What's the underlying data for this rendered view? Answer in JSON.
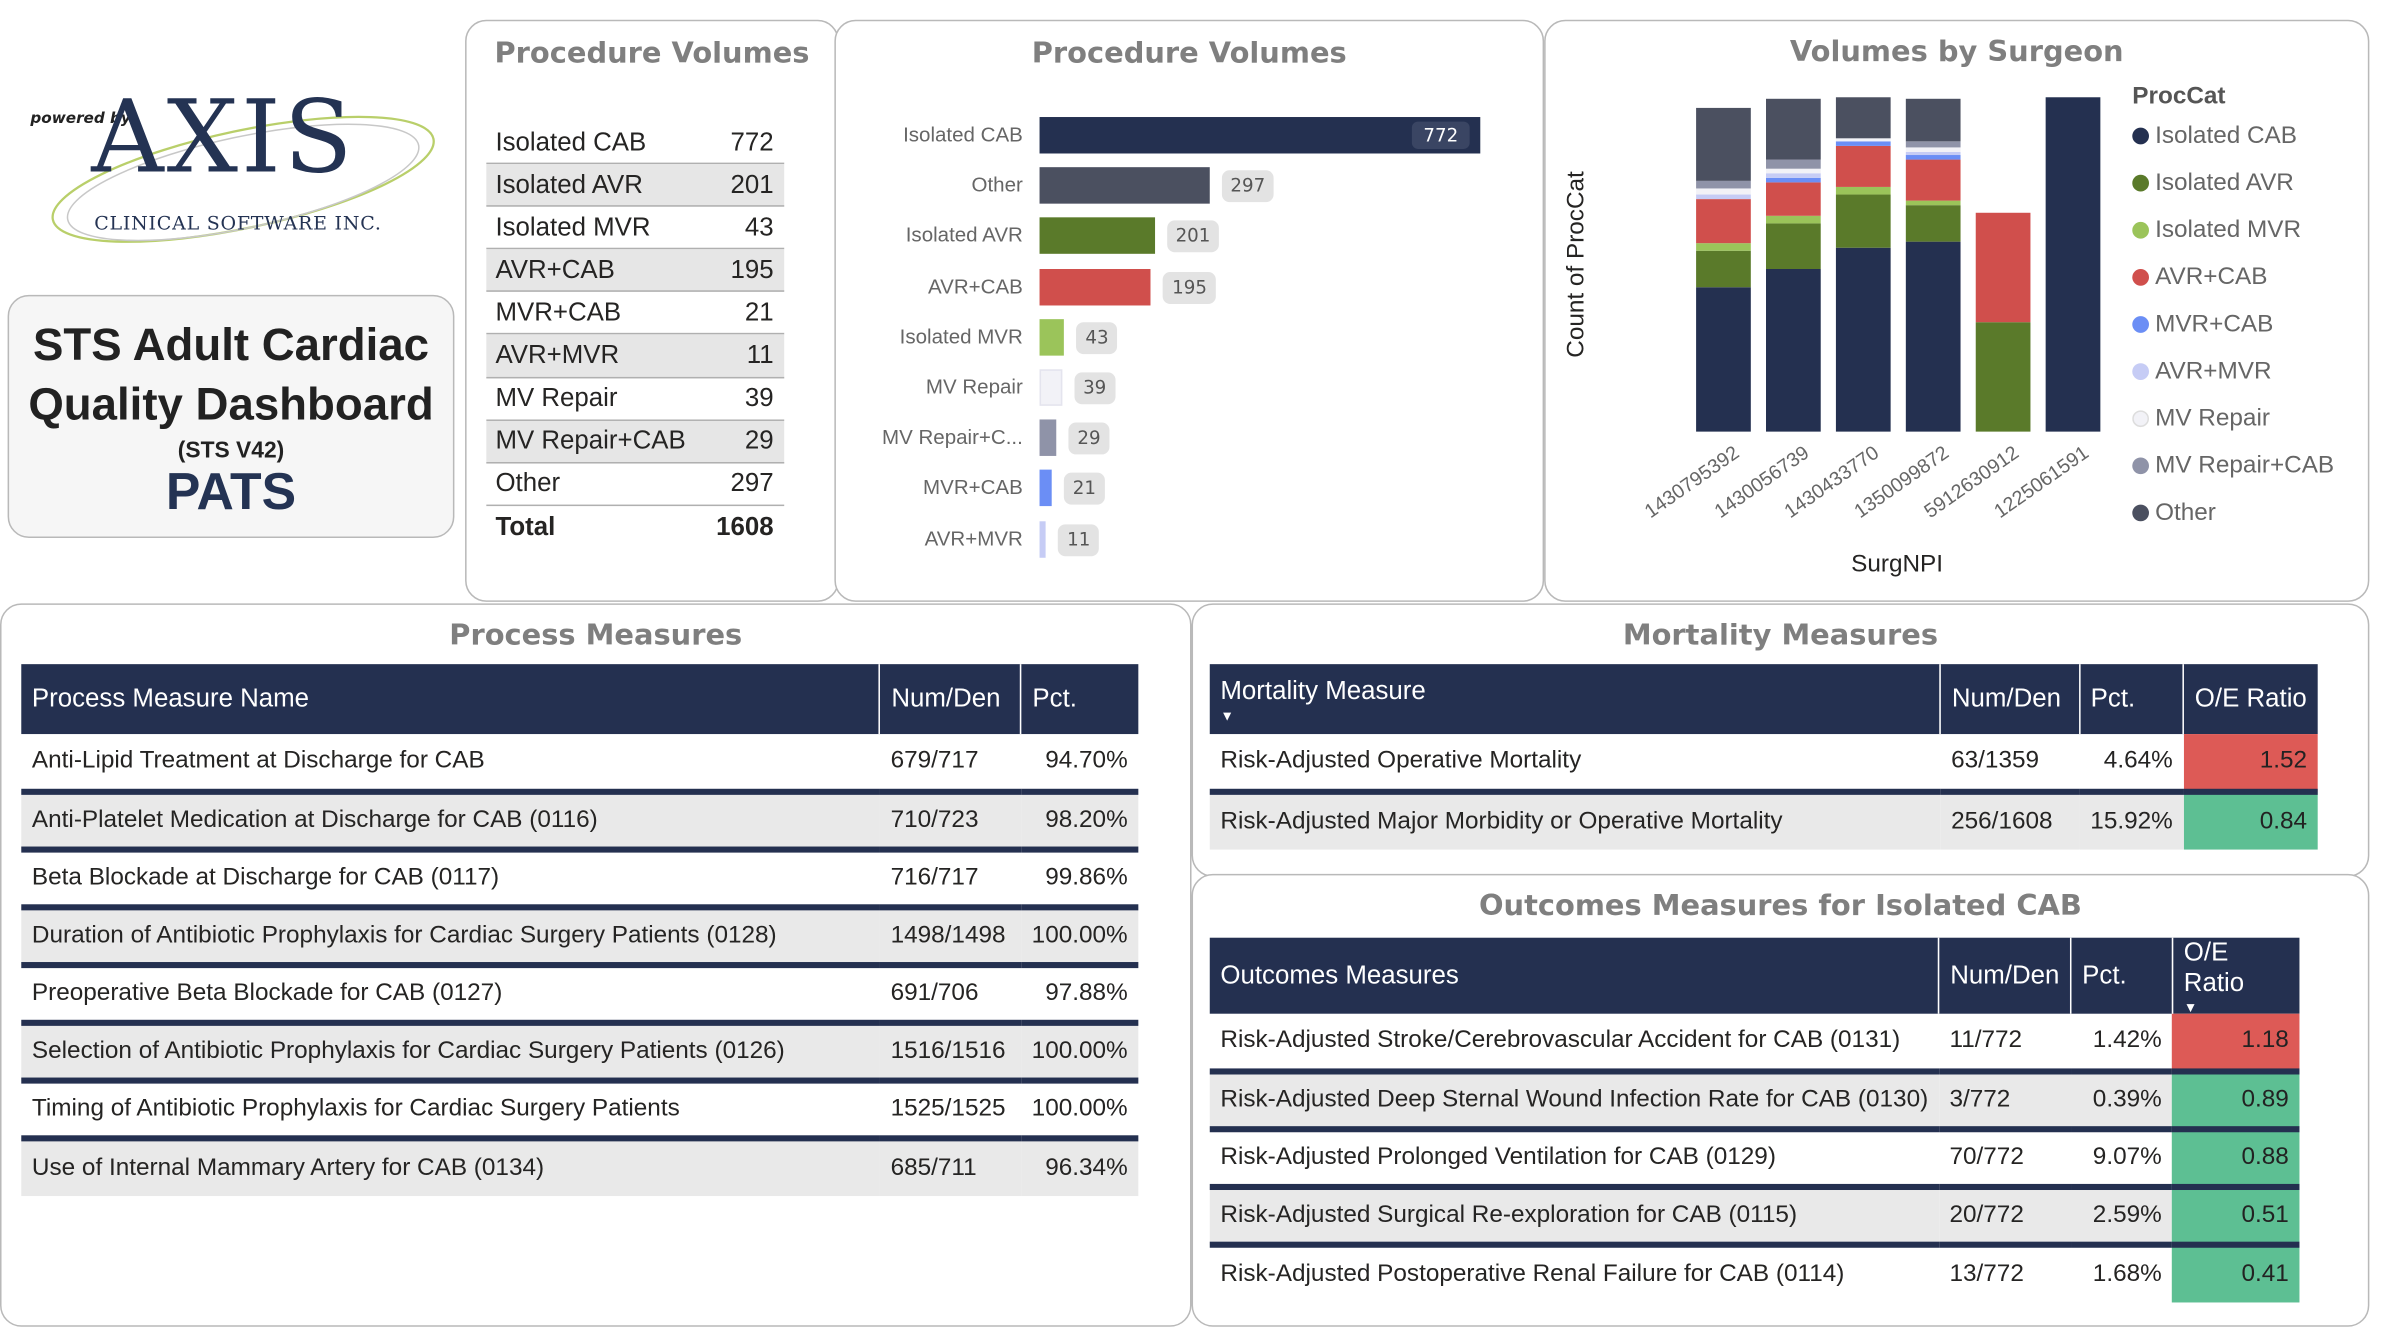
{
  "logo": {
    "powered_by": "powered by",
    "brand": "AXIS",
    "subtitle": "CLINICAL SOFTWARE INC."
  },
  "title_card": {
    "line1": "STS Adult Cardiac",
    "line2": "Quality Dashboard",
    "version": "(STS V42)",
    "pats": "PATS"
  },
  "volume_table": {
    "title": "Procedure Volumes",
    "rows": [
      {
        "name": "Isolated CAB",
        "value": "772"
      },
      {
        "name": "Isolated AVR",
        "value": "201"
      },
      {
        "name": "Isolated MVR",
        "value": "43"
      },
      {
        "name": "AVR+CAB",
        "value": "195"
      },
      {
        "name": "MVR+CAB",
        "value": "21"
      },
      {
        "name": "AVR+MVR",
        "value": "11"
      },
      {
        "name": "MV Repair",
        "value": "39"
      },
      {
        "name": "MV Repair+CAB",
        "value": "29"
      },
      {
        "name": "Other",
        "value": "297"
      }
    ],
    "total_label": "Total",
    "total_value": "1608"
  },
  "chart_data": [
    {
      "type": "bar",
      "orientation": "horizontal",
      "title": "Procedure Volumes",
      "categories": [
        "Isolated CAB",
        "Other",
        "Isolated AVR",
        "AVR+CAB",
        "Isolated MVR",
        "MV Repair",
        "MV Repair+C...",
        "MVR+CAB",
        "AVR+MVR"
      ],
      "values": [
        772,
        297,
        201,
        195,
        43,
        39,
        29,
        21,
        11
      ],
      "colors": [
        "#243050",
        "#4b5060",
        "#5a7a2a",
        "#d04f4c",
        "#9bc45a",
        "#f2f2f7",
        "#8f93a8",
        "#6b8ef5",
        "#c6ccf5"
      ]
    },
    {
      "type": "bar",
      "stacked": true,
      "title": "Volumes by Surgeon",
      "xlabel": "SurgNPI",
      "ylabel": "Count of ProcCat",
      "legend_title": "ProcCat",
      "legend_position": "right",
      "categories": [
        "1430795392",
        "1430056739",
        "1430433770",
        "1350099872",
        "5912630912",
        "1225061591"
      ],
      "series": [
        {
          "name": "Isolated CAB",
          "color": "#243050",
          "values": [
            95,
            107,
            121,
            125,
            0,
            220
          ]
        },
        {
          "name": "Isolated AVR",
          "color": "#5a7a2a",
          "values": [
            24,
            30,
            35,
            24,
            72,
            0
          ]
        },
        {
          "name": "Isolated MVR",
          "color": "#9bc45a",
          "values": [
            5,
            5,
            5,
            3,
            0,
            0
          ]
        },
        {
          "name": "AVR+CAB",
          "color": "#d04f4c",
          "values": [
            29,
            22,
            27,
            27,
            72,
            0
          ]
        },
        {
          "name": "MVR+CAB",
          "color": "#6b8ef5",
          "values": [
            0,
            3,
            3,
            3,
            0,
            0
          ]
        },
        {
          "name": "AVR+MVR",
          "color": "#c6ccf5",
          "values": [
            3,
            3,
            0,
            2,
            0,
            0
          ]
        },
        {
          "name": "MV Repair",
          "color": "#f2f2f7",
          "values": [
            4,
            3,
            2,
            3,
            0,
            0
          ]
        },
        {
          "name": "MV Repair+CAB",
          "color": "#8f93a8",
          "values": [
            5,
            6,
            0,
            4,
            0,
            0
          ]
        },
        {
          "name": "Other",
          "color": "#4b5060",
          "values": [
            48,
            40,
            27,
            28,
            0,
            0
          ]
        }
      ]
    }
  ],
  "process": {
    "title": "Process Measures",
    "headers": [
      "Process Measure Name",
      "Num/Den",
      "Pct."
    ],
    "rows": [
      [
        "Anti-Lipid Treatment at Discharge for CAB",
        "679/717",
        "94.70%"
      ],
      [
        "Anti-Platelet Medication at Discharge for CAB (0116)",
        "710/723",
        "98.20%"
      ],
      [
        "Beta Blockade at Discharge for CAB (0117)",
        "716/717",
        "99.86%"
      ],
      [
        "Duration of Antibiotic Prophylaxis for Cardiac Surgery Patients (0128)",
        "1498/1498",
        "100.00%"
      ],
      [
        "Preoperative Beta Blockade for CAB (0127)",
        "691/706",
        "97.88%"
      ],
      [
        "Selection of Antibiotic Prophylaxis for Cardiac Surgery Patients (0126)",
        "1516/1516",
        "100.00%"
      ],
      [
        "Timing of Antibiotic Prophylaxis for Cardiac Surgery Patients",
        "1525/1525",
        "100.00%"
      ],
      [
        "Use of Internal Mammary Artery for CAB (0134)",
        "685/711",
        "96.34%"
      ]
    ]
  },
  "mortality": {
    "title": "Mortality Measures",
    "headers": [
      "Mortality Measure",
      "Num/Den",
      "Pct.",
      "O/E Ratio"
    ],
    "rows": [
      [
        "Risk-Adjusted Operative Mortality",
        "63/1359",
        "4.64%",
        "1.52"
      ],
      [
        "Risk-Adjusted Major Morbidity or Operative Mortality",
        "256/1608",
        "15.92%",
        "0.84"
      ]
    ],
    "oe_status": [
      "high",
      "low"
    ],
    "high_color": "#dd5a56",
    "low_color": "#5dbf93"
  },
  "outcomes": {
    "title": "Outcomes Measures for Isolated CAB",
    "headers": [
      "Outcomes Measures",
      "Num/Den",
      "Pct.",
      "O/E Ratio"
    ],
    "rows": [
      [
        "Risk-Adjusted Stroke/Cerebrovascular Accident for CAB (0131)",
        "11/772",
        "1.42%",
        "1.18"
      ],
      [
        "Risk-Adjusted Deep Sternal Wound Infection Rate for CAB (0130)",
        "3/772",
        "0.39%",
        "0.89"
      ],
      [
        "Risk-Adjusted Prolonged Ventilation for CAB (0129)",
        "70/772",
        "9.07%",
        "0.88"
      ],
      [
        "Risk-Adjusted Surgical Re-exploration for CAB (0115)",
        "20/772",
        "2.59%",
        "0.51"
      ],
      [
        "Risk-Adjusted Postoperative Renal Failure for CAB (0114)",
        "13/772",
        "1.68%",
        "0.41"
      ]
    ],
    "oe_status": [
      "high",
      "low",
      "low",
      "low",
      "low"
    ]
  }
}
